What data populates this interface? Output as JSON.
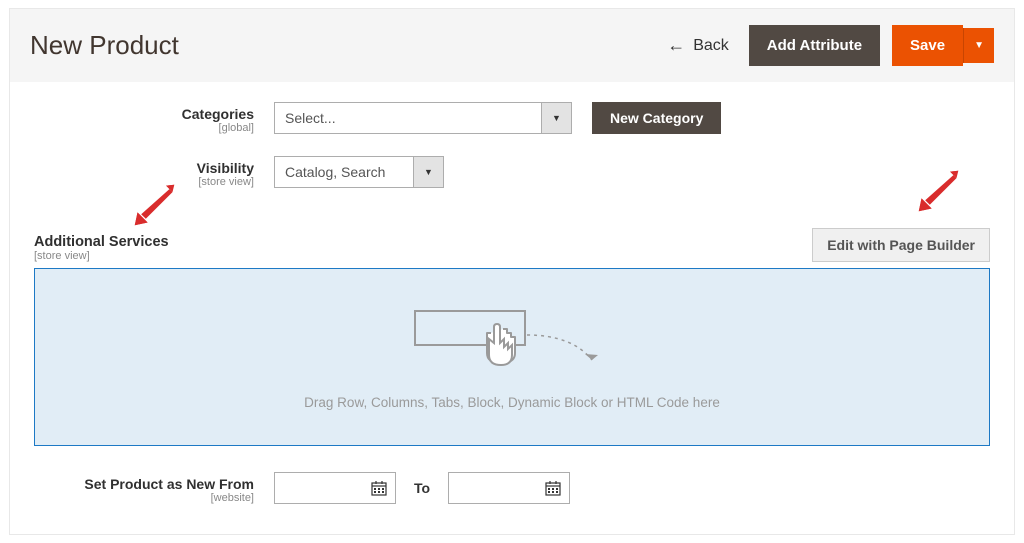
{
  "header": {
    "title": "New Product",
    "back": "Back",
    "add_attribute": "Add Attribute",
    "save": "Save"
  },
  "categories": {
    "label": "Categories",
    "scope": "[global]",
    "placeholder": "Select...",
    "new_btn": "New Category"
  },
  "visibility": {
    "label": "Visibility",
    "scope": "[store view]",
    "value": "Catalog, Search"
  },
  "additional": {
    "label": "Additional Services",
    "scope": "[store view]",
    "edit_btn": "Edit with Page Builder",
    "drop_hint": "Drag Row, Columns, Tabs, Block, Dynamic Block or HTML Code here"
  },
  "setnew": {
    "label": "Set Product as New From",
    "scope": "[website]",
    "to": "To"
  }
}
